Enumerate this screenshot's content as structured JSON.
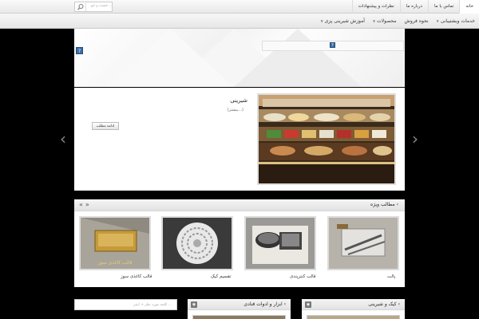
{
  "top_menu": {
    "items": [
      "خانه",
      "تماس با ما",
      "درباره ما",
      "نظرات و پیشنهادات"
    ]
  },
  "search": {
    "placeholder": "جست و جو ..."
  },
  "main_menu": {
    "items": [
      "خدمات وبشتیبانی",
      "نحوه فروش",
      "محصولات",
      "آموزش شیرینی پزی"
    ]
  },
  "slider": {
    "title": "شیرینی",
    "subtitle": "(بیشتر...)",
    "more_button": "ادامه مطلب"
  },
  "featured": {
    "title": "مطالب ویژه",
    "items": [
      {
        "label": "پالت"
      },
      {
        "label": "قالب کنترپندی"
      },
      {
        "label": "تقسیم کیک"
      },
      {
        "label": "قالب کاغذی سوز"
      }
    ]
  },
  "widgets": {
    "left_search_placeholder": "کلمه مورد نظر + اینتر ...",
    "middle_title": "ابزار و ادوات قنادی",
    "right_title": "کیک و شیرینی"
  },
  "colors": {
    "background": "#000000",
    "accent": "#3d6fa8"
  }
}
